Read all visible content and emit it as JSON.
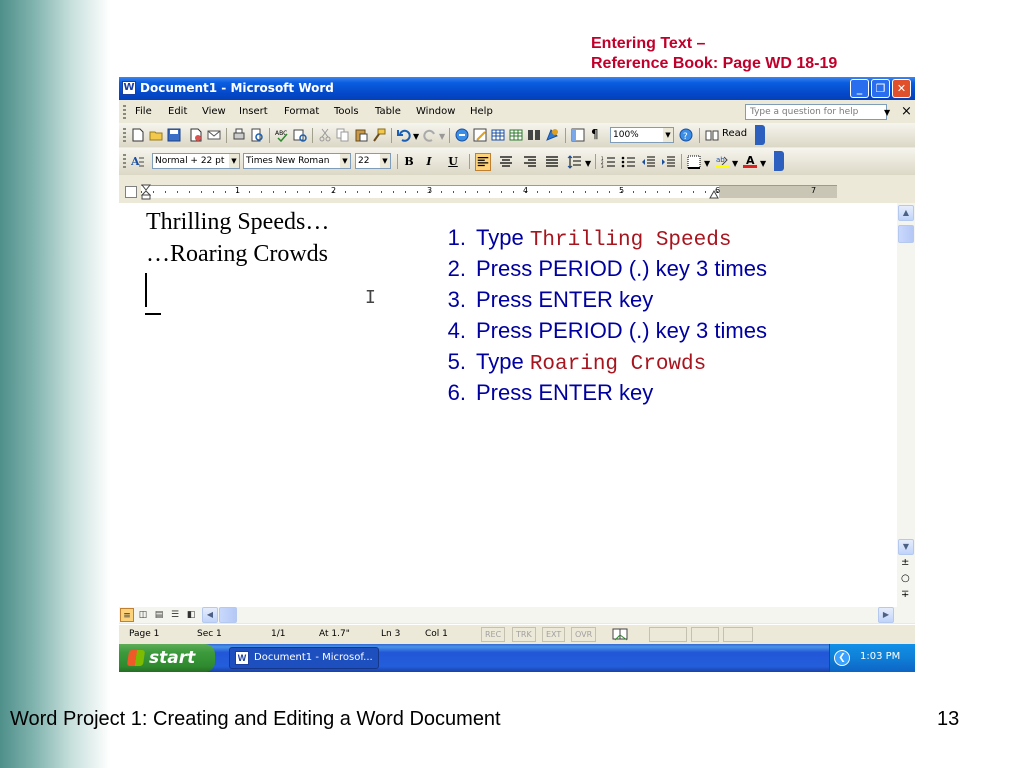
{
  "slide": {
    "ref_line1": "Entering Text –",
    "ref_line2": "Reference Book:  Page WD 18-19",
    "footer_title": "Word Project 1: Creating and Editing a Word Document",
    "slide_number": "13"
  },
  "window": {
    "title": "Document1 - Microsoft Word",
    "buttons": {
      "minimize": "_",
      "restore": "❐",
      "close": "✕"
    }
  },
  "menu": {
    "items": [
      "File",
      "Edit",
      "View",
      "Insert",
      "Format",
      "Tools",
      "Table",
      "Window",
      "Help"
    ],
    "help_placeholder": "Type a question for help",
    "close_doc": "×"
  },
  "standard_toolbar": {
    "zoom": "100%",
    "read_label": "Read"
  },
  "formatting_toolbar": {
    "style": "Normal + 22 pt",
    "font": "Times New Roman",
    "size": "22",
    "bold": "B",
    "italic": "I",
    "underline": "U"
  },
  "ruler": {
    "numbers": [
      "1",
      "2",
      "3",
      "4",
      "5",
      "6",
      "7"
    ]
  },
  "document": {
    "lines": [
      "Thrilling Speeds…",
      "…Roaring Crowds"
    ]
  },
  "steps": [
    {
      "num": "1.",
      "prefix": "Type ",
      "code": "Thrilling Speeds",
      "text": ""
    },
    {
      "num": "2.",
      "prefix": "",
      "code": "",
      "text": "Press PERIOD (.) key 3 times"
    },
    {
      "num": "3.",
      "prefix": "",
      "code": "",
      "text": "Press ENTER key"
    },
    {
      "num": "4.",
      "prefix": "",
      "code": "",
      "text": "Press PERIOD (.) key 3 times"
    },
    {
      "num": "5.",
      "prefix": "Type ",
      "code": "Roaring Crowds",
      "text": ""
    },
    {
      "num": "6.",
      "prefix": "",
      "code": "",
      "text": "Press ENTER key"
    }
  ],
  "statusbar": {
    "page": "Page 1",
    "sec": "Sec 1",
    "pages": "1/1",
    "at": "At 1.7\"",
    "ln": "Ln 3",
    "col": "Col 1",
    "modes": [
      "REC",
      "TRK",
      "EXT",
      "OVR"
    ]
  },
  "taskbar": {
    "start": "start",
    "task_label": "Document1 - Microsof...",
    "clock": "1:03 PM"
  },
  "colors": {
    "ref_title": "#c0002b",
    "steps_text": "#0000a0",
    "steps_code": "#a8141e",
    "titlebar": "#0a5de0"
  }
}
